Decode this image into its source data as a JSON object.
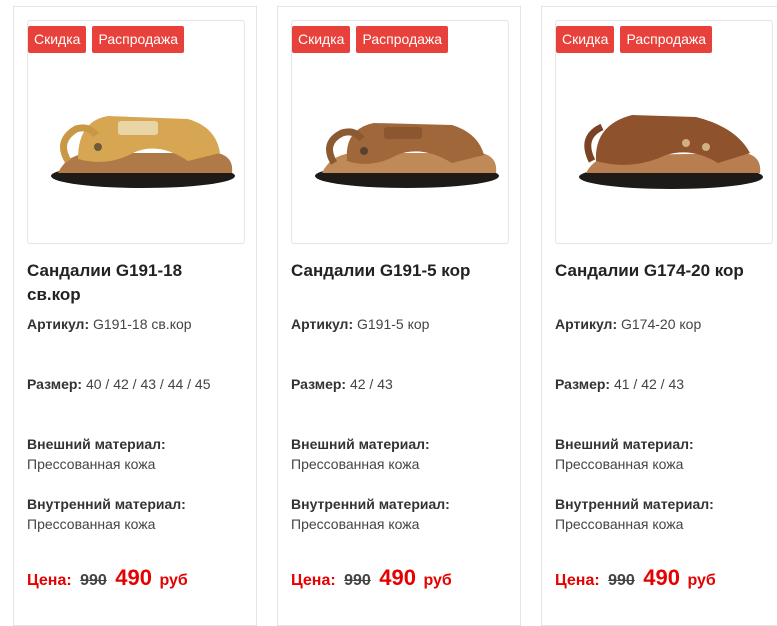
{
  "products": [
    {
      "badges": [
        "Скидка",
        "Распродажа"
      ],
      "title": "Сандалии G191-18 св.кор",
      "sku_label": "Артикул:",
      "sku": "G191-18 св.кор",
      "size_label": "Размер:",
      "sizes": "40 / 42 / 43 / 44 / 45",
      "outer_label": "Внешний материал:",
      "outer": "Прессованная кожа",
      "inner_label": "Внутренний материал:",
      "inner": "Прессованная кожа",
      "price_label": "Цена:",
      "old_price": "990",
      "new_price": "490",
      "currency": "руб",
      "shoe_color": "#d7a653"
    },
    {
      "badges": [
        "Скидка",
        "Распродажа"
      ],
      "title": "Сандалии G191-5 кор",
      "sku_label": "Артикул:",
      "sku": "G191-5 кор",
      "size_label": "Размер:",
      "sizes": "42 / 43",
      "outer_label": "Внешний материал:",
      "outer": "Прессованная кожа",
      "inner_label": "Внутренний материал:",
      "inner": "Прессованная кожа",
      "price_label": "Цена:",
      "old_price": "990",
      "new_price": "490",
      "currency": "руб",
      "shoe_color": "#a0683a"
    },
    {
      "badges": [
        "Скидка",
        "Распродажа"
      ],
      "title": "Сандалии G174-20 кор",
      "sku_label": "Артикул:",
      "sku": "G174-20 кор",
      "size_label": "Размер:",
      "sizes": "41 / 42 / 43",
      "outer_label": "Внешний материал:",
      "outer": "Прессованная кожа",
      "inner_label": "Внутренний материал:",
      "inner": "Прессованная кожа",
      "price_label": "Цена:",
      "old_price": "990",
      "new_price": "490",
      "currency": "руб",
      "shoe_color": "#8e522c"
    }
  ],
  "colors": {
    "badge": "#e8413b",
    "price": "#e60000"
  }
}
